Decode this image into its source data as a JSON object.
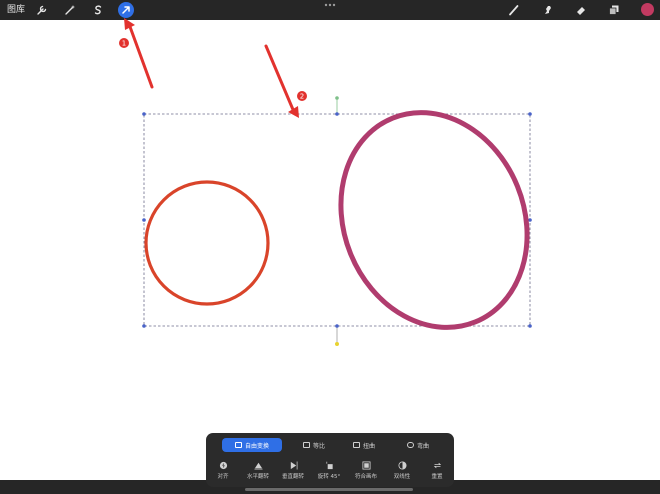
{
  "topbar": {
    "gallery_label": "图库",
    "tools_left": [
      {
        "icon": "wrench-icon"
      },
      {
        "icon": "magic-wand-icon"
      },
      {
        "icon": "selection-s-icon"
      },
      {
        "icon": "transform-arrow-icon",
        "active": true
      }
    ],
    "tools_right": [
      {
        "icon": "brush-icon"
      },
      {
        "icon": "smudge-icon"
      },
      {
        "icon": "eraser-icon"
      },
      {
        "icon": "layers-icon"
      }
    ],
    "current_color": "#c23a61",
    "accent_color": "#2f6fe6"
  },
  "annotations": [
    {
      "label": "1"
    },
    {
      "label": "2"
    }
  ],
  "canvas": {
    "shapes": [
      {
        "type": "circle",
        "color": "#d9442a"
      },
      {
        "type": "ellipse",
        "color": "#b03c6e"
      }
    ]
  },
  "transform_panel": {
    "modes": [
      {
        "label": "自由变换",
        "active": true
      },
      {
        "label": "等比",
        "active": false
      },
      {
        "label": "扭曲",
        "active": false
      },
      {
        "label": "弯曲",
        "active": false
      }
    ],
    "actions": [
      {
        "label": "对齐",
        "icon": "magnet-icon"
      },
      {
        "label": "水平翻转",
        "icon": "flip-horizontal-icon"
      },
      {
        "label": "垂直翻转",
        "icon": "flip-vertical-icon"
      },
      {
        "label": "旋转 45°",
        "icon": "rotate-icon"
      },
      {
        "label": "符合画布",
        "icon": "fit-canvas-icon"
      },
      {
        "label": "双线性",
        "icon": "bilinear-icon"
      },
      {
        "label": "重置",
        "icon": "reset-icon"
      }
    ]
  }
}
